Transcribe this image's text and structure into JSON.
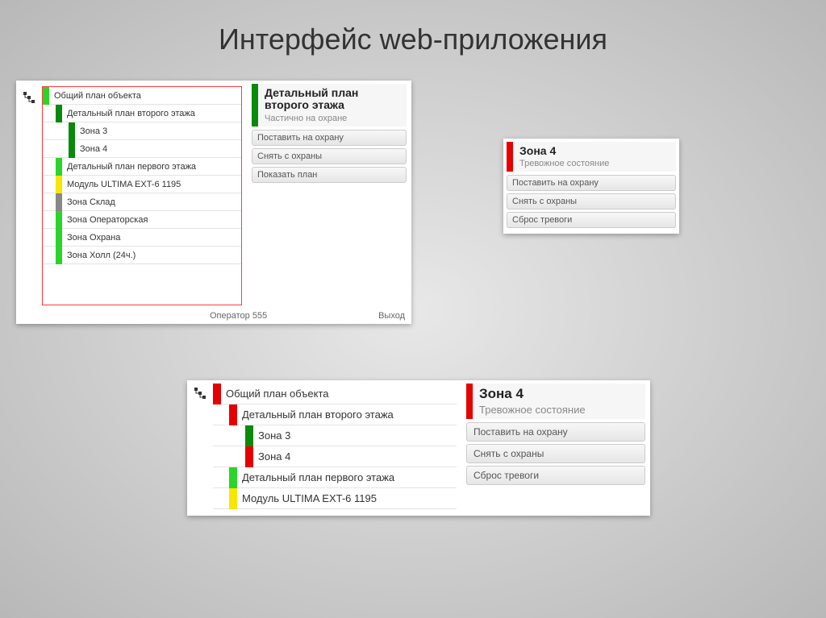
{
  "title": "Интерфейс web-приложения",
  "tree1": {
    "items": [
      {
        "level": "lvl0",
        "color": "c-green",
        "label": "Общий план объекта"
      },
      {
        "level": "lvl1",
        "color": "c-dgreen",
        "label": "Детальный план второго этажа"
      },
      {
        "level": "lvl2",
        "color": "c-dgreen",
        "label": "Зона 3"
      },
      {
        "level": "lvl2",
        "color": "c-dgreen",
        "label": "Зона 4"
      },
      {
        "level": "lvl1",
        "color": "c-green",
        "label": "Детальный план первого этажа"
      },
      {
        "level": "lvl1",
        "color": "c-yellow",
        "label": "Модуль ULTIMA EXT-6 1195"
      },
      {
        "level": "lvl1",
        "color": "c-grey",
        "label": "Зона Склад"
      },
      {
        "level": "lvl1",
        "color": "c-green",
        "label": "Зона Операторская"
      },
      {
        "level": "lvl1",
        "color": "c-green",
        "label": "Зона Охрана"
      },
      {
        "level": "lvl1",
        "color": "c-green",
        "label": "Зона Холл (24ч.)"
      }
    ]
  },
  "detail1": {
    "title": "Детальный план второго этажа",
    "subtitle": "Частично на охране",
    "buttons": [
      "Поставить на охрану",
      "Снять с охраны",
      "Показать план"
    ]
  },
  "footer1": {
    "operator": "Оператор 555",
    "exit": "Выход"
  },
  "panel2": {
    "title": "Зона 4",
    "subtitle": "Тревожное состояние",
    "buttons": [
      "Поставить на охрану",
      "Снять с охраны",
      "Сброс тревоги"
    ]
  },
  "tree3": {
    "items": [
      {
        "level": "lvl0",
        "color": "c-red",
        "label": "Общий план объекта"
      },
      {
        "level": "lvl1",
        "color": "c-red",
        "label": "Детальный план второго этажа"
      },
      {
        "level": "lvl2",
        "color": "c-dgreen",
        "label": "Зона 3"
      },
      {
        "level": "lvl2",
        "color": "c-red",
        "label": "Зона 4"
      },
      {
        "level": "lvl1",
        "color": "c-green",
        "label": "Детальный план первого этажа"
      },
      {
        "level": "lvl1",
        "color": "c-yellow",
        "label": "Модуль ULTIMA EXT-6 1195"
      }
    ]
  },
  "detail3": {
    "title": "Зона 4",
    "subtitle": "Тревожное состояние",
    "buttons": [
      "Поставить на охрану",
      "Снять с охраны",
      "Сброс тревоги"
    ]
  }
}
